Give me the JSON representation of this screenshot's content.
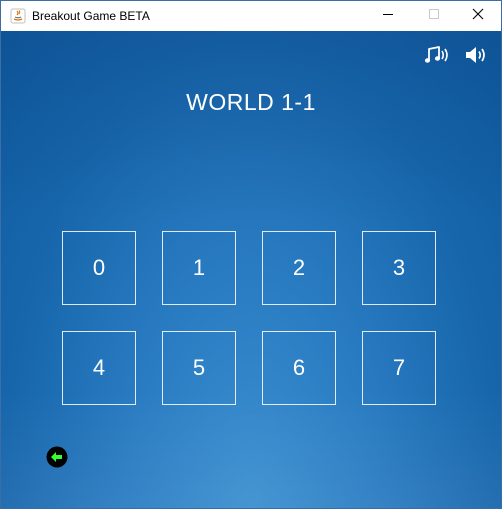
{
  "window": {
    "title": "Breakout Game BETA",
    "icon": "java-icon",
    "controls": [
      "minimize-icon",
      "maximize-icon",
      "close-icon"
    ]
  },
  "game": {
    "world_title": "WORLD 1-1",
    "top_icons": [
      "music-note-icon",
      "speaker-icon"
    ],
    "levels": [
      "0",
      "1",
      "2",
      "3",
      "4",
      "5",
      "6",
      "7"
    ],
    "back_icon": "back-arrow-icon",
    "colors": {
      "background": "#1766ac",
      "text": "#ffffff",
      "back_button_fill": "#000000",
      "back_button_arrow": "#33ff33"
    }
  }
}
